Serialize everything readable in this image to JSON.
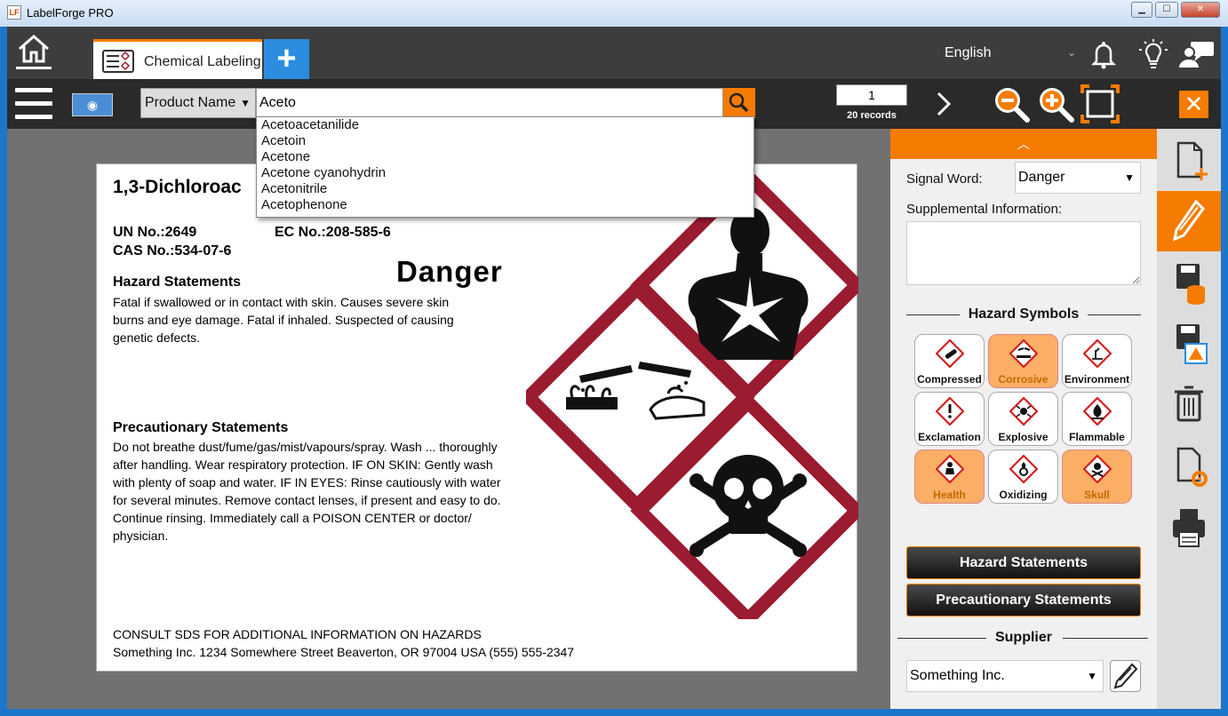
{
  "window": {
    "title": "LabelForge PRO",
    "app_icon_text": "LF"
  },
  "tabs": [
    {
      "label": "Chemical Labeling"
    }
  ],
  "header": {
    "language": "English"
  },
  "search": {
    "field": "Product Name",
    "query": "Aceto",
    "suggestions": [
      "Acetoacetanilide",
      "Acetoin",
      "Acetone",
      "Acetone cyanohydrin",
      "Acetonitrile",
      "Acetophenone"
    ]
  },
  "pager": {
    "page": "1",
    "records": "20 records"
  },
  "label": {
    "product_name": "1,3-Dichloroac",
    "un_no": "UN No.:2649",
    "ec_no": "EC No.:208-585-6",
    "cas_no": "CAS No.:534-07-6",
    "signal_word": "Danger",
    "hazard_heading": "Hazard Statements",
    "hazard_lines": [
      "Fatal if swallowed or in contact with skin. Causes severe skin",
      "burns and eye damage. Fatal if inhaled. Suspected of causing",
      "genetic defects."
    ],
    "precaution_heading": "Precautionary Statements",
    "precaution_lines": [
      "Do not breathe dust/fume/gas/mist/vapours/spray. Wash ... thoroughly",
      "after handling. Wear respiratory protection. IF ON SKIN: Gently wash",
      "with plenty of soap and water. IF IN EYES: Rinse cautiously with water",
      "for several minutes. Remove contact lenses, if present and easy to do.",
      "Continue rinsing. Immediately call a POISON CENTER or doctor/",
      "physician."
    ],
    "consult": "CONSULT SDS FOR ADDITIONAL INFORMATION ON HAZARDS",
    "supplier_line": "Something Inc. 1234 Somewhere Street  Beaverton, OR 97004 USA (555) 555-2347",
    "pictograms": [
      "health-hazard",
      "corrosive",
      "skull-crossbones"
    ]
  },
  "panel": {
    "signal_label": "Signal Word:",
    "signal_value": "Danger",
    "supp_label": "Supplemental Information:",
    "symbols_heading": "Hazard Symbols",
    "symbols": [
      {
        "label": "Compressed",
        "selected": false,
        "icon": "gas-cylinder-icon"
      },
      {
        "label": "Corrosive",
        "selected": true,
        "icon": "corrosive-icon"
      },
      {
        "label": "Environment",
        "selected": false,
        "icon": "environment-icon"
      },
      {
        "label": "Exclamation",
        "selected": false,
        "icon": "exclamation-icon"
      },
      {
        "label": "Explosive",
        "selected": false,
        "icon": "explosive-icon"
      },
      {
        "label": "Flammable",
        "selected": false,
        "icon": "flame-icon"
      },
      {
        "label": "Health",
        "selected": true,
        "icon": "health-hazard-icon"
      },
      {
        "label": "Oxidizing",
        "selected": false,
        "icon": "oxidizer-icon"
      },
      {
        "label": "Skull",
        "selected": true,
        "icon": "skull-icon"
      }
    ],
    "hazard_btn": "Hazard Statements",
    "precaution_btn": "Precautionary Statements",
    "supplier_heading": "Supplier",
    "supplier_value": "Something Inc."
  },
  "colors": {
    "accent": "#f57c00",
    "ghs_red": "#9b1b30",
    "blue": "#2a8de0"
  }
}
